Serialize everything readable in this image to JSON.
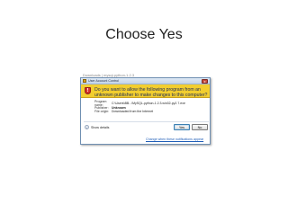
{
  "slide": {
    "title": "Choose Yes"
  },
  "background_window": {
    "title": "Downloads | mysql-python-1.2.3"
  },
  "dialog": {
    "title": "User Account Control",
    "close_glyph": "x",
    "shield_glyph": "!",
    "warning": "Do you want to allow the following program from an unknown publisher to make changes to this computer?",
    "details": [
      {
        "label": "Program name:",
        "value": "C:\\Users\\BB...\\MySQL-python-1.2.3.win32-py2.7.exe"
      },
      {
        "label": "Publisher:",
        "value": "Unknown"
      },
      {
        "label": "File origin:",
        "value": "Downloaded from the Internet"
      }
    ],
    "show_details_glyph": "⌄",
    "show_details_label": "Show details",
    "yes_label": "Yes",
    "no_label": "No",
    "change_link": "Change when these notifications appear"
  },
  "colors": {
    "warning_band": "#f2ce2f",
    "shield": "#d4312a",
    "link": "#1f5db7"
  }
}
